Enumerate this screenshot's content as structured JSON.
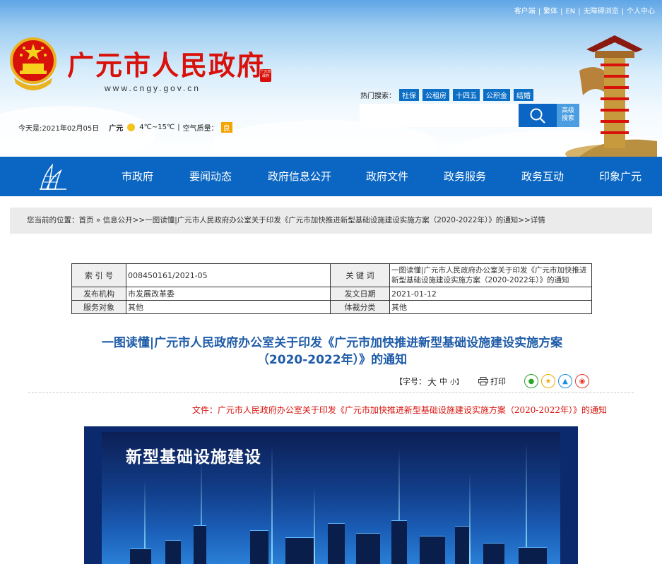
{
  "top_links": [
    "客户端",
    "繁体",
    "EN",
    "无障碍浏览",
    "个人中心"
  ],
  "site": {
    "title": "广元市人民政府",
    "seal_text": "广元市政府",
    "url": "www.cngy.gov.cn"
  },
  "weather": {
    "date": "今天是:2021年02月05日",
    "city": "广元",
    "temp": "4℃~15℃",
    "aq_label": "空气质量：",
    "aq_value": "良"
  },
  "hot_search": {
    "label": "热门搜索：",
    "tags": [
      "社保",
      "公租房",
      "十四五",
      "公积金",
      "结婚"
    ]
  },
  "search": {
    "placeholder": "",
    "advanced_label_1": "高级",
    "advanced_label_2": "搜索"
  },
  "nav": [
    "市政府",
    "要闻动态",
    "政府信息公开",
    "政府文件",
    "政务服务",
    "政务互动",
    "印象广元"
  ],
  "breadcrumb": "您当前的位置：首页 » 信息公开>>一图读懂|广元市人民政府办公室关于印发《广元市加快推进新型基础设施建设实施方案（2020-2022年）》的通知>>详情",
  "meta": {
    "index_label": "索 引 号",
    "index_value": "008450161/2021-05",
    "keyword_label": "关 键 词",
    "keyword_value": "一图读懂|广元市人民政府办公室关于印发《广元市加快推进新型基础设施建设实施方案（2020-2022年）》的通知",
    "org_label": "发布机构",
    "org_value": "市发展改革委",
    "date_label": "发文日期",
    "date_value": "2021-01-12",
    "target_label": "服务对象",
    "target_value": "其他",
    "genre_label": "体裁分类",
    "genre_value": "其他"
  },
  "article": {
    "title_line1": "一图读懂|广元市人民政府办公室关于印发《广元市加快推进新型基础设施建设实施方案",
    "title_line2": "（2020-2022年）》的通知",
    "font_size_label": "【字号：",
    "font_big": "大",
    "font_mid": "中",
    "font_small": "小】",
    "print_label": "打印",
    "file_line": "文件：广元市人民政府办公室关于印发《广元市加快推进新型基础设施建设实施方案（2020-2022年）》的通知",
    "poster_title": "新型基础设施建设"
  },
  "colors": {
    "brand_red": "#d8120b",
    "nav_blue": "#0a66c2",
    "title_blue": "#1e5ba8"
  }
}
